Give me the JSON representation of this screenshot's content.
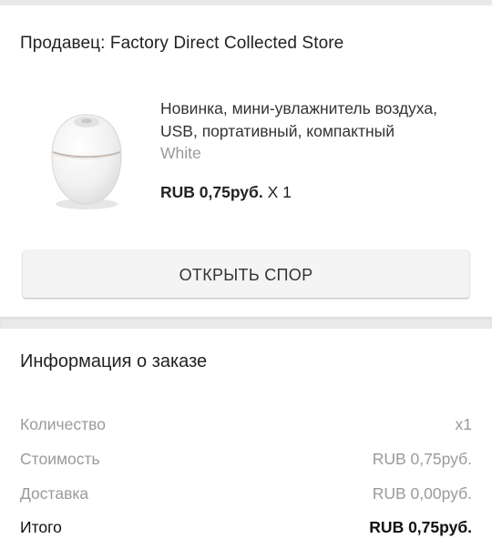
{
  "seller": {
    "title": "Продавец: Factory Direct Collected Store"
  },
  "product": {
    "name": "Новинка, мини-увлажнитель воздуха, USB, портативный, компактный",
    "variant": "White",
    "price": "RUB 0,75руб.",
    "quantity": "X 1",
    "image_icon": "humidifier-image"
  },
  "dispute": {
    "button_label": "ОТКРЫТЬ СПОР"
  },
  "order_info": {
    "title": "Информация о заказе",
    "rows": [
      {
        "label": "Количество",
        "value": "x1"
      },
      {
        "label": "Стоимость",
        "value": "RUB 0,75руб."
      },
      {
        "label": "Доставка",
        "value": "RUB 0,00руб."
      }
    ],
    "total": {
      "label": "Итого",
      "value": "RUB 0,75руб."
    }
  },
  "colors": {
    "background": "#e9e9e9",
    "card": "#ffffff",
    "muted_text": "#9a9a9a",
    "button_bg": "#f4f4f4"
  }
}
